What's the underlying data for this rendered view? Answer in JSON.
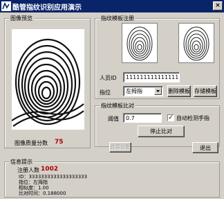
{
  "window": {
    "title": "酷管指纹识别应用演示",
    "close_glyph": "×"
  },
  "preview": {
    "group_title": "图像预览",
    "quality_label": "图像质量分数",
    "quality_value": "75"
  },
  "enroll": {
    "group_title": "指纹模板注册",
    "id_label": "人员ID",
    "id_value": "1111111111111111111",
    "finger_label": "指位",
    "finger_value": "左拇指",
    "delete_button": "删除模板",
    "save_button": "存储模板"
  },
  "compare": {
    "group_title": "指纹模板比对",
    "threshold_label": "阈值",
    "threshold_value": "0.7",
    "auto_detect_label": "自动检测手指",
    "auto_detect_checked": true,
    "stop_button": "停止比对"
  },
  "actions": {
    "connect_button": "连接设备",
    "exit_button": "退出"
  },
  "info": {
    "group_title": "信息提示",
    "registered_label": "注册人数",
    "registered_value": "1002",
    "lines": [
      "ID：3333333333333333333",
      "指位：左拇指",
      "相似度：1.00",
      "比对时间：0.188000"
    ]
  },
  "colors": {
    "title_bar": "#0a246a",
    "accent_value": "#b00000",
    "window_bg": "#d4d0c8"
  }
}
